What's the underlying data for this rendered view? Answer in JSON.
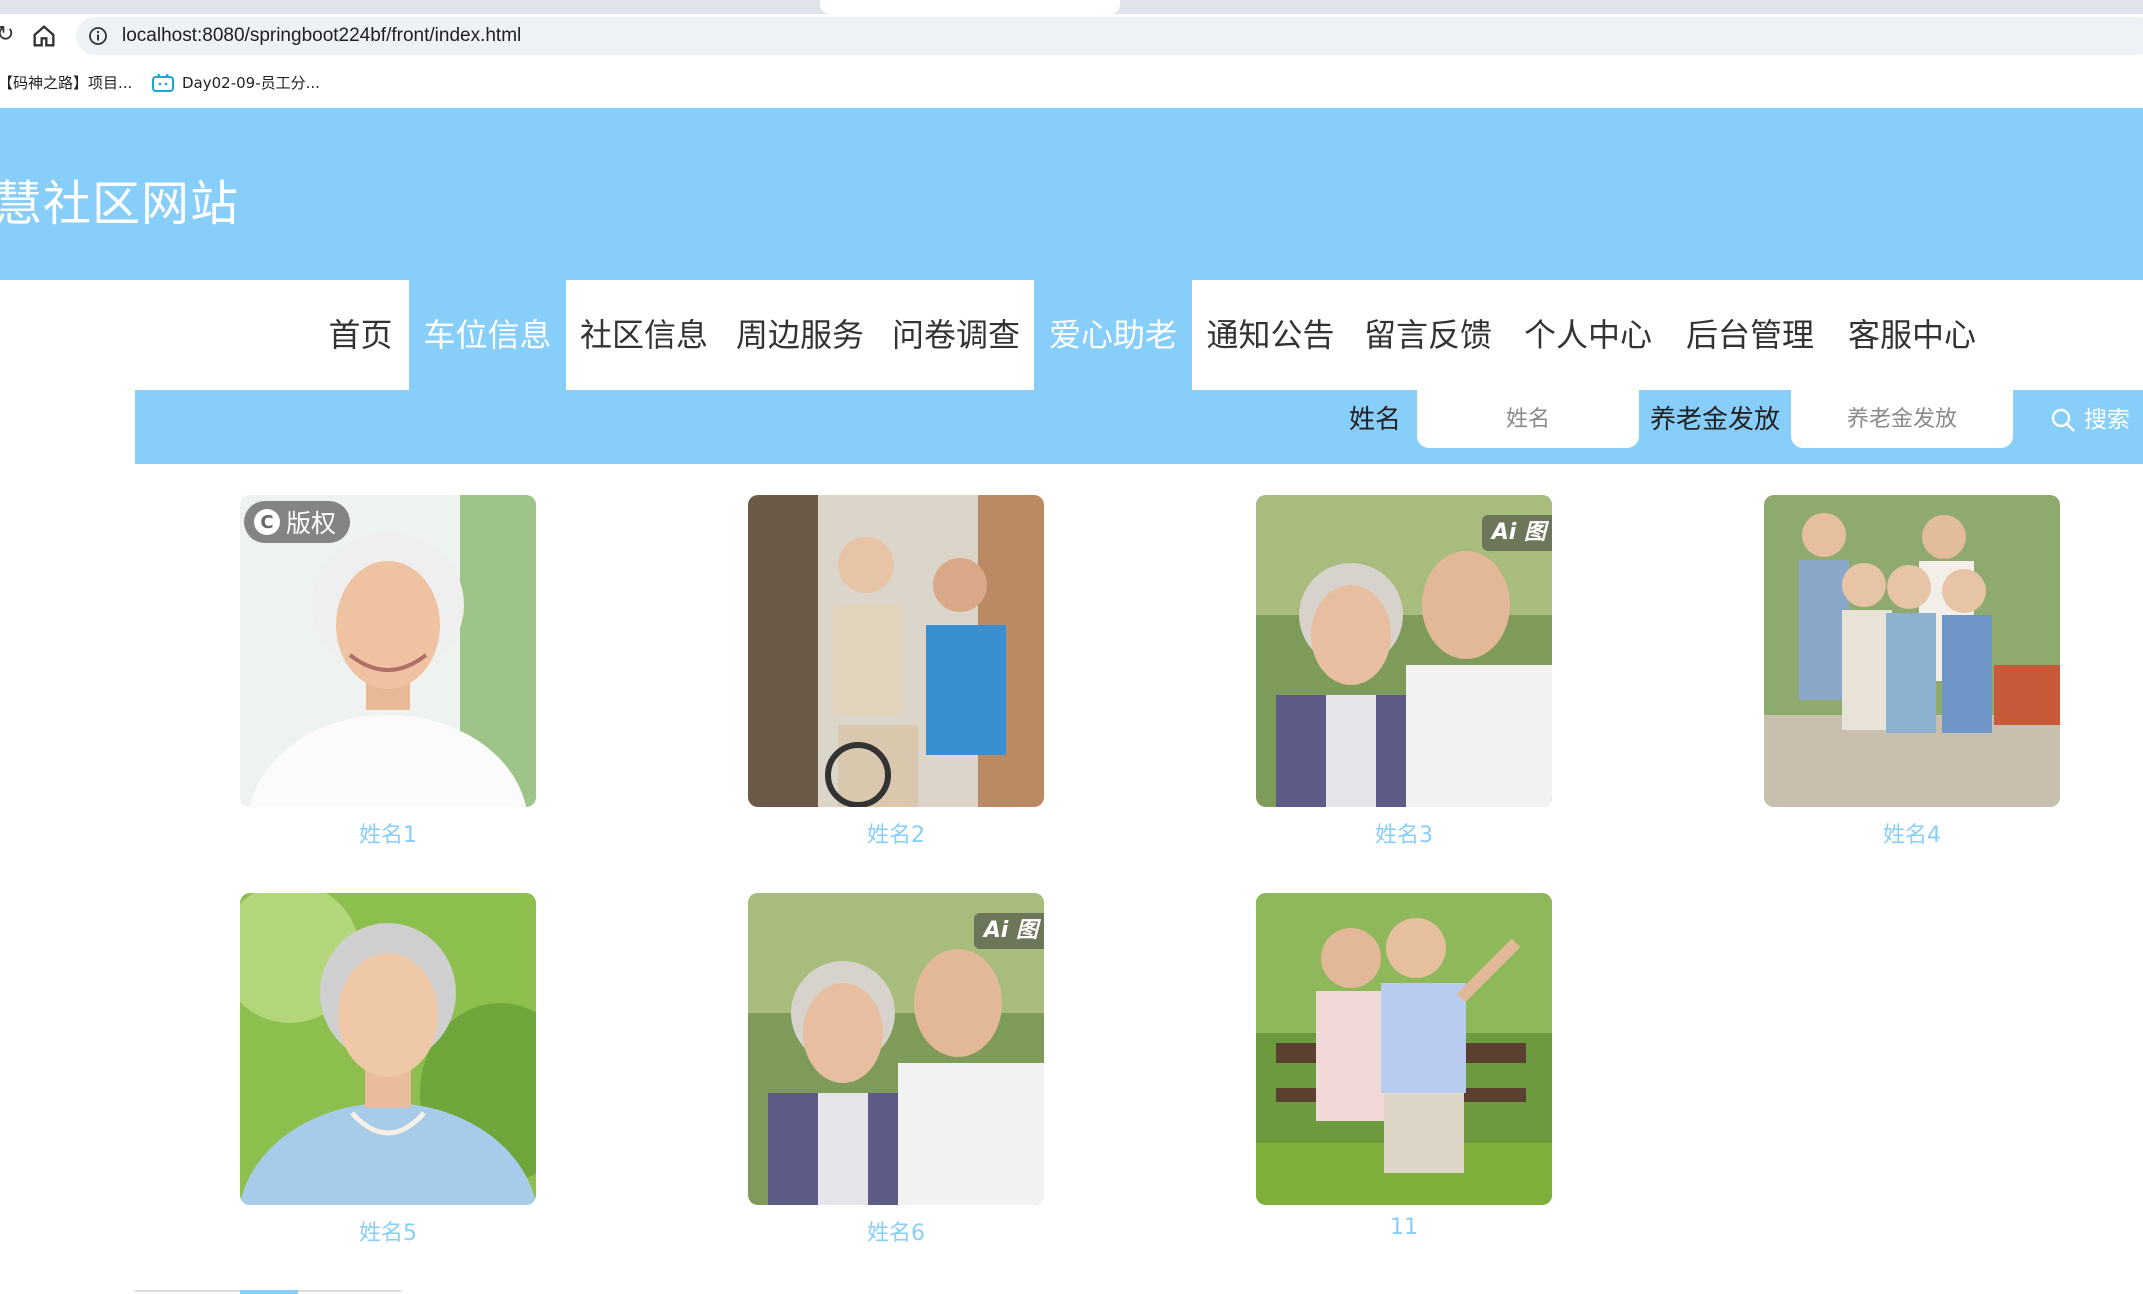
{
  "browser": {
    "url": "localhost:8080/springboot224bf/front/index.html",
    "bookmarks": [
      {
        "label": "【码神之路】项目..."
      },
      {
        "label": "Day02-09-员工分..."
      }
    ]
  },
  "site": {
    "title": "慧社区网站"
  },
  "nav": {
    "items": [
      {
        "label": "首页"
      },
      {
        "label": "车位信息"
      },
      {
        "label": "社区信息"
      },
      {
        "label": "周边服务"
      },
      {
        "label": "问卷调查"
      },
      {
        "label": "爱心助老"
      },
      {
        "label": "通知公告"
      },
      {
        "label": "留言反馈"
      },
      {
        "label": "个人中心"
      },
      {
        "label": "后台管理"
      },
      {
        "label": "客服中心"
      }
    ]
  },
  "search": {
    "fields": [
      {
        "label": "姓名",
        "placeholder": "姓名"
      },
      {
        "label": "养老金发放",
        "placeholder": "养老金发放"
      }
    ],
    "button_label": "搜索"
  },
  "cards": [
    {
      "name": "姓名1",
      "badge": "版权"
    },
    {
      "name": "姓名2"
    },
    {
      "name": "姓名3",
      "badge": "Ai 图"
    },
    {
      "name": "姓名4"
    },
    {
      "name": "姓名5"
    },
    {
      "name": "姓名6",
      "badge": "Ai 图"
    },
    {
      "name": "11"
    }
  ],
  "colors": {
    "accent": "#87cefa",
    "card_name": "#87cefa"
  }
}
